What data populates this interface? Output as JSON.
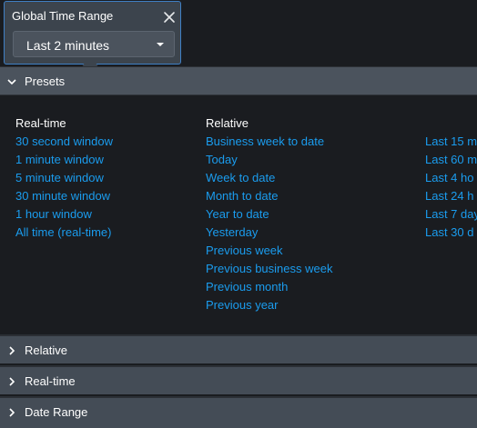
{
  "picker": {
    "label": "Global Time Range",
    "selected": "Last 2 minutes"
  },
  "presets": {
    "title": "Presets",
    "realtime": {
      "heading": "Real-time",
      "items": [
        "30 second window",
        "1 minute window",
        "5 minute window",
        "30 minute window",
        "1 hour window",
        "All time (real-time)"
      ]
    },
    "relative": {
      "heading": "Relative",
      "items": [
        "Business week to date",
        "Today",
        "Week to date",
        "Month to date",
        "Year to date",
        "Yesterday",
        "Previous week",
        "Previous business week",
        "Previous month",
        "Previous year"
      ]
    },
    "other": {
      "items": [
        "Last 15 m",
        "Last 60 m",
        "Last 4 ho",
        "Last 24 h",
        "Last 7 day",
        "Last 30 d"
      ]
    }
  },
  "sections": [
    {
      "title": "Relative"
    },
    {
      "title": "Real-time"
    },
    {
      "title": "Date Range"
    }
  ],
  "colors": {
    "link": "#1a9cee",
    "accent_border": "#3f7fc4"
  }
}
